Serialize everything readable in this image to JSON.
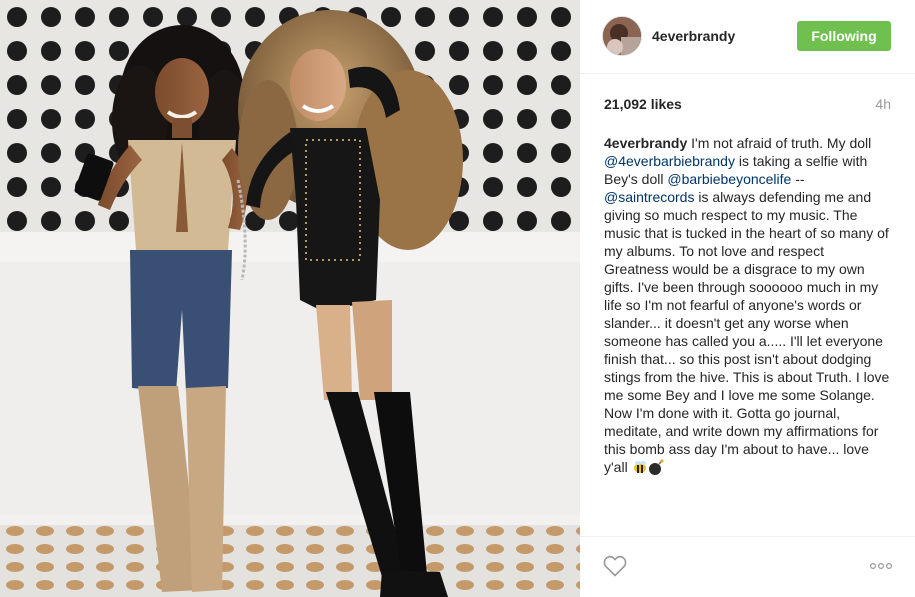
{
  "post": {
    "username": "4everbrandy",
    "follow_label": "Following",
    "likes": "21,092 likes",
    "time": "4h",
    "caption_user": "4everbrandy",
    "caption_parts": {
      "p1": " I'm not afraid of truth. My doll ",
      "m1": "@4everbarbiebrandy",
      "p2": " is taking a selfie with Bey's doll ",
      "m2": "@barbiebeyoncelife",
      "p3": " -- ",
      "m3": "@saintrecords",
      "p4": " is always defending me and giving so much respect to my music. The music that is tucked in the heart of so many of my albums. To not love and respect Greatness would be a disgrace to my own gifts. I've been through soooooo much in my life so I'm not fearful of anyone's words or slander... it doesn't get any worse when someone has called you a..... I'll let everyone finish that... so this post isn't about dodging stings from the hive. This is about Truth. I love me some Bey and I love me some Solange. Now I'm done with it. Gotta go journal, meditate, and write down my affirmations for this bomb ass day I'm about to have... love y'all "
    }
  },
  "icons": {
    "heart": "heart-outline-icon",
    "more": "more-options-icon",
    "emoji": [
      "bee-emoji",
      "bomb-emoji"
    ]
  },
  "colors": {
    "follow_button": "#70c050",
    "mention": "#003569",
    "muted": "#999999"
  }
}
